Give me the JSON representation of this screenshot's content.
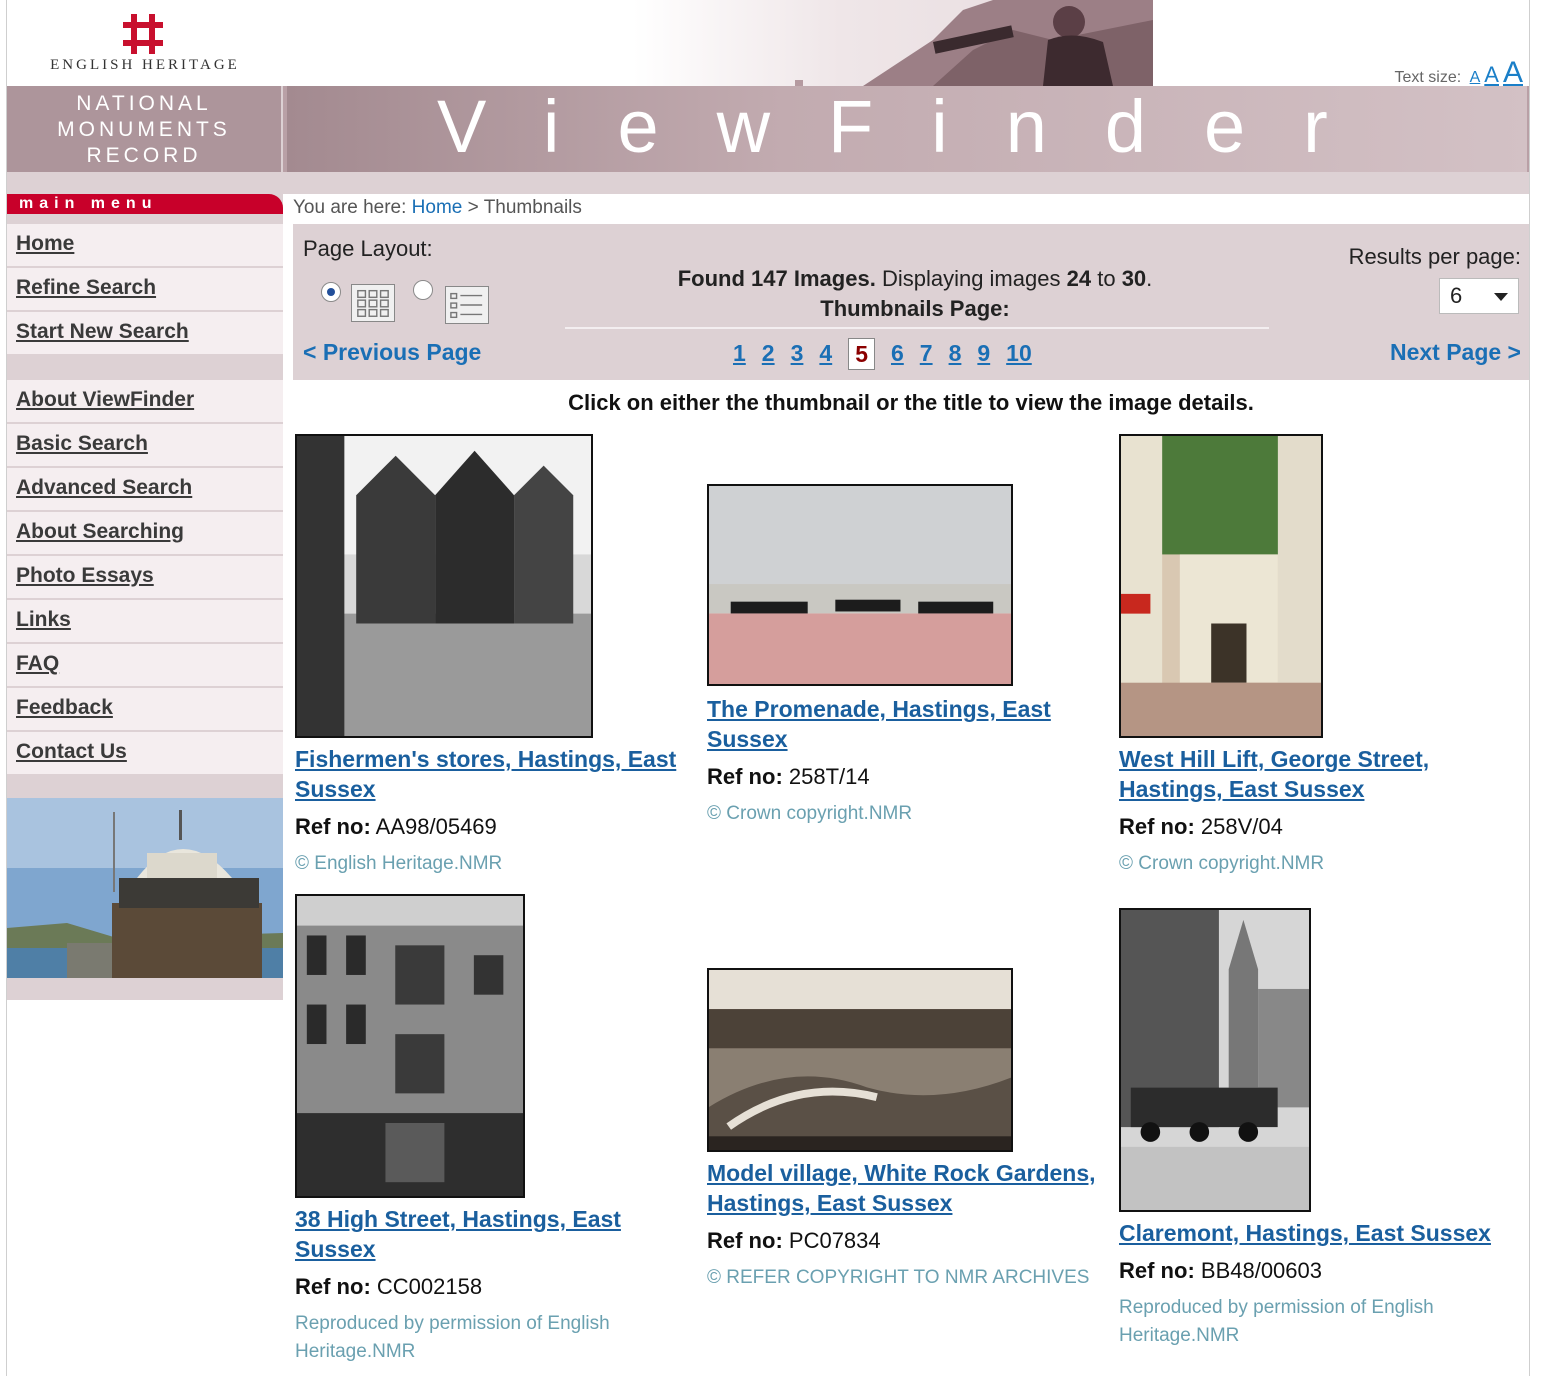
{
  "header": {
    "logo_text": "ENGLISH HERITAGE",
    "text_size_label": "Text size:",
    "text_size_options": [
      "A",
      "A",
      "A"
    ],
    "nmr_lines": [
      "NATIONAL",
      "MONUMENTS",
      "RECORD"
    ],
    "site_title": "ViewFinder"
  },
  "sidebar": {
    "menu_tab": "main menu",
    "group_a": [
      "Home",
      "Refine Search",
      "Start New Search"
    ],
    "group_b": [
      "About ViewFinder",
      "Basic Search",
      "Advanced Search",
      "About Searching",
      "Photo Essays",
      "Links",
      "FAQ",
      "Feedback",
      "Contact Us"
    ]
  },
  "breadcrumb": {
    "prefix": "You are here:",
    "home": "Home",
    "separator": ">",
    "current": "Thumbnails"
  },
  "controls": {
    "page_layout_label": "Page Layout:",
    "layout_selected": "grid",
    "found_prefix": "Found",
    "found_count": "147",
    "found_suffix": "Images.",
    "displaying_text": "Displaying images",
    "from": "24",
    "to_word": "to",
    "to": "30",
    "thumbnails_page_label": "Thumbnails Page:",
    "results_per_page_label": "Results per page:",
    "results_per_page_value": "6",
    "prev_label": "< Previous Page",
    "next_label": "Next Page >",
    "pages": [
      "1",
      "2",
      "3",
      "4",
      "5",
      "6",
      "7",
      "8",
      "9",
      "10"
    ],
    "current_page": "5"
  },
  "instruction": "Click on either the thumbnail or the title to view the image details.",
  "results": [
    {
      "title": "Fishermen's stores, Hastings, East Sussex",
      "ref_label": "Ref no:",
      "ref": "AA98/05469",
      "copyright": "© English Heritage.NMR"
    },
    {
      "title": "The Promenade, Hastings, East Sussex",
      "ref_label": "Ref no:",
      "ref": "258T/14",
      "copyright": "©  Crown copyright.NMR"
    },
    {
      "title": "West Hill Lift, George Street, Hastings, East Sussex",
      "ref_label": "Ref no:",
      "ref": "258V/04",
      "copyright": "©  Crown copyright.NMR"
    },
    {
      "title": "38 High Street, Hastings, East Sussex",
      "ref_label": "Ref no:",
      "ref": "CC002158",
      "copyright": "Reproduced by permission of English Heritage.NMR"
    },
    {
      "title": "Model village, White Rock Gardens, Hastings, East Sussex",
      "ref_label": "Ref no:",
      "ref": "PC07834",
      "copyright": "© REFER COPYRIGHT TO NMR ARCHIVES"
    },
    {
      "title": "Claremont, Hastings, East Sussex",
      "ref_label": "Ref no:",
      "ref": "BB48/00603",
      "copyright": "Reproduced by permission of English Heritage.NMR"
    }
  ]
}
